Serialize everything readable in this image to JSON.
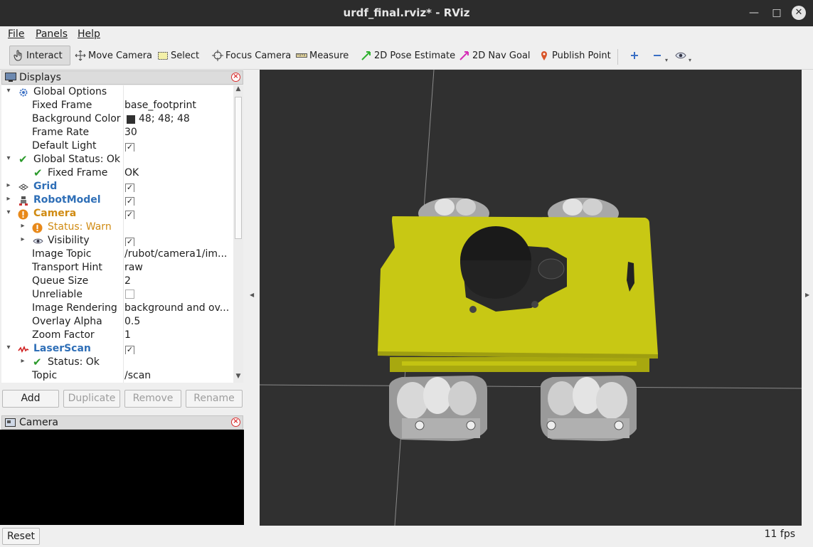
{
  "window": {
    "title": "urdf_final.rviz* - RViz"
  },
  "menu": {
    "file": "File",
    "panels": "Panels",
    "help": "Help"
  },
  "toolbar": {
    "interact": "Interact",
    "move_camera": "Move Camera",
    "select": "Select",
    "focus_camera": "Focus Camera",
    "measure": "Measure",
    "pose_estimate": "2D Pose Estimate",
    "nav_goal": "2D Nav Goal",
    "publish_point": "Publish Point",
    "colors": {
      "pose_estimate": "#2fb12f",
      "nav_goal": "#d62fb6",
      "publish_point": "#d8552a"
    }
  },
  "displays": {
    "title": "Displays",
    "rows": [
      {
        "name": "Global Options",
        "value": ""
      },
      {
        "name": "Fixed Frame",
        "value": "base_footprint"
      },
      {
        "name": "Background Color",
        "value": "48; 48; 48"
      },
      {
        "name": "Frame Rate",
        "value": "30"
      },
      {
        "name": "Default Light",
        "value": ""
      },
      {
        "name": "Global Status: Ok",
        "value": ""
      },
      {
        "name": "Fixed Frame",
        "value": "OK"
      },
      {
        "name": "Grid",
        "value": ""
      },
      {
        "name": "RobotModel",
        "value": ""
      },
      {
        "name": "Camera",
        "value": ""
      },
      {
        "name": "Status: Warn",
        "value": ""
      },
      {
        "name": "Visibility",
        "value": ""
      },
      {
        "name": "Image Topic",
        "value": "/rubot/camera1/im..."
      },
      {
        "name": "Transport Hint",
        "value": "raw"
      },
      {
        "name": "Queue Size",
        "value": "2"
      },
      {
        "name": "Unreliable",
        "value": ""
      },
      {
        "name": "Image Rendering",
        "value": "background and ov..."
      },
      {
        "name": "Overlay Alpha",
        "value": "0.5"
      },
      {
        "name": "Zoom Factor",
        "value": "1"
      },
      {
        "name": "LaserScan",
        "value": ""
      },
      {
        "name": "Status: Ok",
        "value": ""
      },
      {
        "name": "Topic",
        "value": "/scan"
      }
    ],
    "background_color_swatch": "#303030",
    "buttons": {
      "add": "Add",
      "duplicate": "Duplicate",
      "remove": "Remove",
      "rename": "Rename"
    }
  },
  "camera_panel": {
    "title": "Camera"
  },
  "status": {
    "reset": "Reset",
    "fps": "11 fps"
  },
  "scene": {
    "background": "#303030",
    "chassis_color": "#c8c814"
  }
}
